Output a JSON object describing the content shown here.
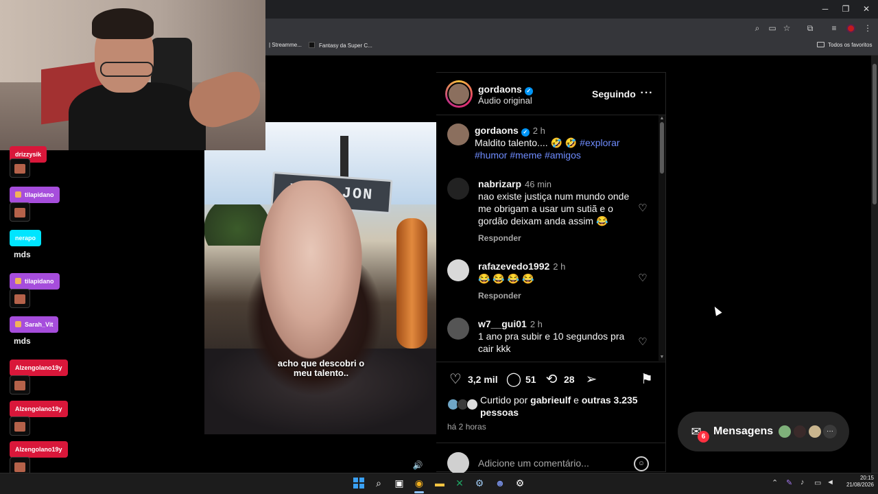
{
  "browser": {
    "bookmarks": [
      {
        "label": "| Streamme..."
      },
      {
        "label": "Fantasy da Super C..."
      }
    ],
    "favorites_folder": "Todos os favoritos"
  },
  "post": {
    "author": "gordaons",
    "audio": "Áudio original",
    "follow_state": "Seguindo",
    "caption_author": "gordaons",
    "caption_time": "2 h",
    "caption_text": "Maldito talento.... 🤣 🤣",
    "hashtags": [
      "#explorar",
      "#humor",
      "#meme",
      "#amigos"
    ],
    "video_caption": "acho que descobri o meu talento..",
    "video_sign": "VILA JON",
    "comments": [
      {
        "user": "nabrizarp",
        "time": "46 min",
        "text": "nao existe justiça num mundo onde me obrigam a usar um sutiã e o gordão deixam anda assim 😂",
        "reply": "Responder"
      },
      {
        "user": "rafazevedo1992",
        "time": "2 h",
        "text": "😂 😂 😂 😂",
        "reply": "Responder"
      },
      {
        "user": "w7__gui01",
        "time": "2 h",
        "text": "1 ano pra subir e 10 segundos pra cair kkk"
      }
    ],
    "likes": "3,2 mil",
    "comments_count": "51",
    "reposts": "28",
    "liked_by_prefix": "Curtido por",
    "liked_by_user": "gabrieulf",
    "liked_by_suffix": "e",
    "liked_by_others": "outras 3.235 pessoas",
    "posted_ago": "há 2 horas",
    "comment_placeholder": "Adicione um comentário..."
  },
  "messages": {
    "label": "Mensagens",
    "badge": "6"
  },
  "chat": {
    "entries": [
      {
        "user": "drizzysik",
        "color": "#d9173a"
      },
      {
        "user": "tilapidano",
        "color": "#a64ddc"
      },
      {
        "user": "nerapo",
        "color": "#00e5ff"
      },
      {
        "user": "tilapidano",
        "color": "#a64ddc"
      },
      {
        "user": "Sarah_Vit",
        "color": "#a64ddc"
      },
      {
        "user": "Alzengolano19y",
        "color": "#d9173a"
      },
      {
        "user": "Alzengolano19y",
        "color": "#d9173a"
      },
      {
        "user": "Alzengolano19y",
        "color": "#d9173a"
      }
    ],
    "messages": [
      "mds",
      "mds"
    ],
    "emote_badge": "6"
  },
  "taskbar": {
    "time": "20:15",
    "date": "21/08/2026"
  },
  "icons": [
    "search-icon",
    "cast-icon",
    "star-icon",
    "extensions-icon",
    "menu-icon",
    "heart-icon",
    "comment-icon",
    "repost-icon",
    "share-icon",
    "bookmark-icon",
    "emoji-icon",
    "volume-icon",
    "messages-icon",
    "windows-icon",
    "chrome-icon",
    "folder-icon",
    "steam-icon",
    "discord-icon"
  ],
  "colors": {
    "accent_link": "#6f8cff",
    "verified": "#0095f6",
    "badge": "#ff3040"
  }
}
